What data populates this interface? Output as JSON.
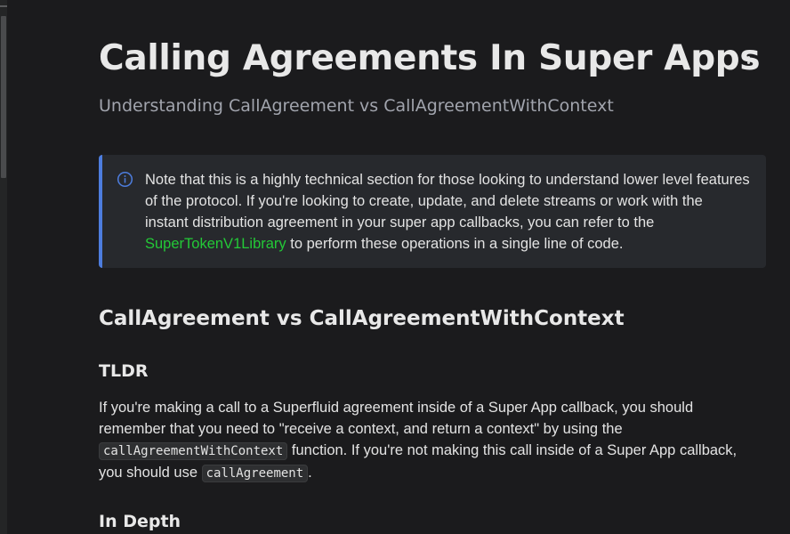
{
  "header": {
    "title": "Calling Agreements In Super Apps",
    "subtitle": "Understanding CallAgreement vs CallAgreementWithContext",
    "menu_icon": "kebab-menu-icon"
  },
  "note": {
    "icon": "info-circle-icon",
    "text_before_link": "Note that this is a highly technical section for those looking to understand lower level features of the protocol. If you're looking to create, update, and delete streams or work with the instant distribution agreement in your super app callbacks, you can refer to the ",
    "link_text": "SuperTokenV1Library",
    "text_after_link": " to perform these operations in a single line of code.",
    "accent_color": "#4d7dde",
    "link_color": "#23c937"
  },
  "section": {
    "heading": "CallAgreement vs CallAgreementWithContext",
    "tldr_heading": "TLDR",
    "tldr_text_1": "If you're making a call to a Superfluid agreement inside of a Super App callback, you should remember that you need to \"receive a context, and return a context\" by using the ",
    "tldr_code_1": "callAgreementWithContext",
    "tldr_text_2": " function. If you're not making this call inside of a Super App callback, you should use ",
    "tldr_code_2": "callAgreement",
    "tldr_text_3": ".",
    "depth_heading": "In Depth"
  }
}
